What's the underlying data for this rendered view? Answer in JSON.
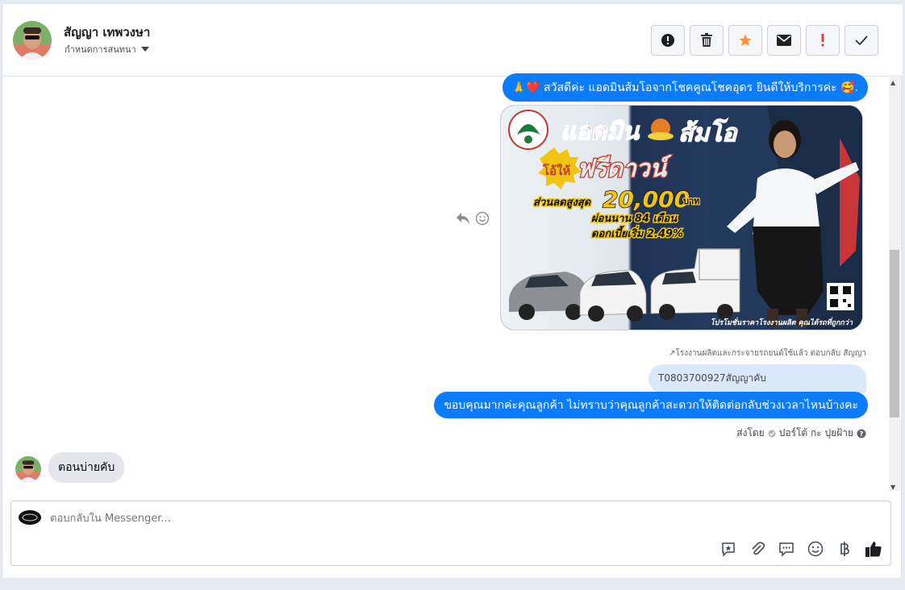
{
  "header": {
    "contact_name": "สัญญา เทพวงษา",
    "assign_label": "กำหนดการสนทนา",
    "tools": [
      {
        "icon": "alert-circle-icon",
        "name": "tool-alert"
      },
      {
        "icon": "trash-icon",
        "name": "tool-delete"
      },
      {
        "icon": "star-icon",
        "name": "tool-star"
      },
      {
        "icon": "mail-icon",
        "name": "tool-mail"
      },
      {
        "icon": "exclamation-icon",
        "name": "tool-important"
      },
      {
        "icon": "check-icon",
        "name": "tool-done"
      }
    ]
  },
  "messages": {
    "greeting": "🙏❤️ สวัสดีค่ะ แอดมินส้มโอจากโชคคูณโชคอุดร ยินดีให้บริการค่ะ 🥰.",
    "promo": {
      "title_1": "แอดมิน",
      "title_2": "ส้มโอ",
      "give_label": "โอ้ให้",
      "free_down": "ฟรีดาวน์",
      "discount_label": "ส่วนลดสูงสุด",
      "discount_value": "20,000",
      "discount_unit": "บาท",
      "installment": "ผ่อนนาน 84 เดือน",
      "interest": "ดอกเบี้ยเริ่ม 2.49%",
      "footer": "โปรโมชั่นราคาโรงงานผลิต คุณได้รถที่ถูกกว่า"
    },
    "reply_note": "↗โรงงานผลิตและกระจายรถยนต์ใช้แล้ว ตอบกลับ สัญญา",
    "quoted": "T0803700927สัญญาคับ",
    "reply": "ขอบคุณมากค่ะคุณลูกค้า ไม่ทราบว่าคุณลูกค้าสะดวกให้ติดต่อกลับช่วงเวลาไหนบ้างคะ",
    "sent_by_prefix": "ส่งโดย",
    "sent_by_name": "ปอร์โต้ กะ ปุยฝ้าย",
    "incoming": "ตอนบ่ายคับ"
  },
  "composer": {
    "placeholder": "ตอบกลับใน Messenger...",
    "tools": [
      "saved-reply-icon",
      "attach-icon",
      "chat-icon",
      "emoji-icon",
      "baht-icon",
      "like-icon"
    ]
  },
  "colors": {
    "accent": "#0a7cff",
    "star": "#f7923b",
    "important": "#e0442e"
  }
}
